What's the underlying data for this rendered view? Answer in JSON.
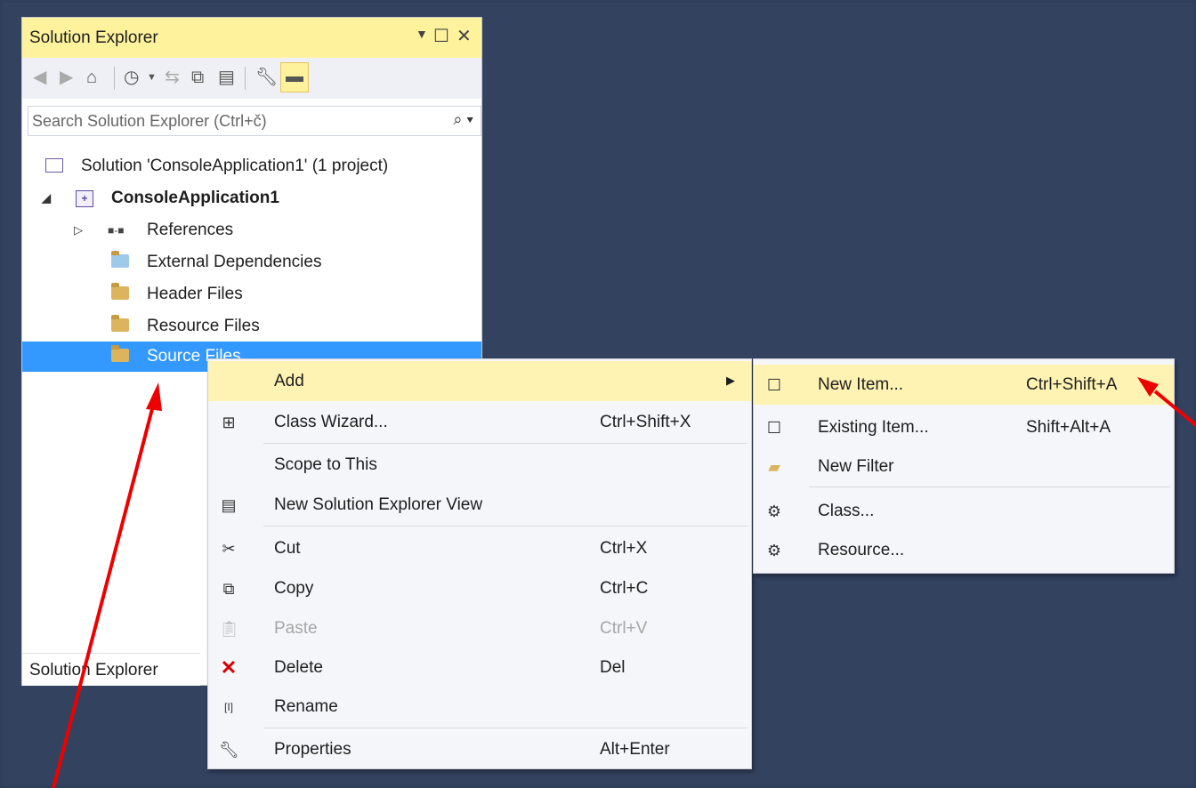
{
  "solution_explorer": {
    "title": "Solution Explorer",
    "search_placeholder": "Search Solution Explorer (Ctrl+č)",
    "tree": [
      {
        "label": "Solution 'ConsoleApplication1' (1 project)"
      },
      {
        "label": "ConsoleApplication1"
      },
      {
        "label": "References"
      },
      {
        "label": "External Dependencies"
      },
      {
        "label": "Header Files"
      },
      {
        "label": "Resource Files"
      },
      {
        "label": "Source Files"
      }
    ],
    "bottom_tab": "Solution Explorer"
  },
  "context_menu": {
    "items": [
      {
        "label": "Add",
        "shortcut": ""
      },
      {
        "label": "Class Wizard...",
        "shortcut": "Ctrl+Shift+X"
      },
      {
        "label": "Scope to This",
        "shortcut": ""
      },
      {
        "label": "New Solution Explorer View",
        "shortcut": ""
      },
      {
        "label": "Cut",
        "shortcut": "Ctrl+X"
      },
      {
        "label": "Copy",
        "shortcut": "Ctrl+C"
      },
      {
        "label": "Paste",
        "shortcut": "Ctrl+V"
      },
      {
        "label": "Delete",
        "shortcut": "Del"
      },
      {
        "label": "Rename",
        "shortcut": ""
      },
      {
        "label": "Properties",
        "shortcut": "Alt+Enter"
      }
    ]
  },
  "add_submenu": {
    "items": [
      {
        "label": "New Item...",
        "shortcut": "Ctrl+Shift+A"
      },
      {
        "label": "Existing Item...",
        "shortcut": "Shift+Alt+A"
      },
      {
        "label": "New Filter",
        "shortcut": ""
      },
      {
        "label": "Class...",
        "shortcut": ""
      },
      {
        "label": "Resource...",
        "shortcut": ""
      }
    ]
  },
  "colors": {
    "background": "#33425f",
    "title_bar": "#fff29d",
    "selection": "#3399ff",
    "highlight": "#fff3b3",
    "annotation_arrow": "#ee0000"
  }
}
